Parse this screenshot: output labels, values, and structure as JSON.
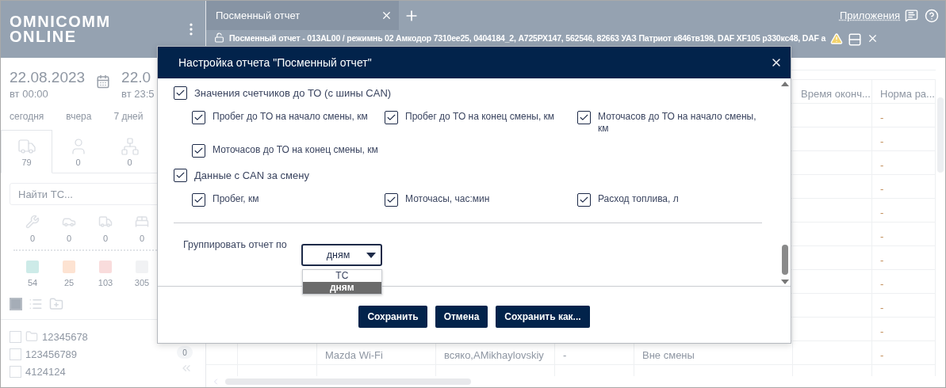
{
  "sidebar": {
    "logo": [
      "OMNICOMM",
      "ONLINE"
    ],
    "period": [
      {
        "date": "22.08.2023",
        "time": "вт 00:00"
      },
      {
        "date": "22.0",
        "time": "вт 23:5"
      }
    ],
    "quick_ranges": [
      "сегодня",
      "вчера",
      "7 дней"
    ],
    "object_tabs": [
      {
        "kind": "vehicles",
        "count": "79",
        "selected": true
      },
      {
        "kind": "drivers",
        "count": "0",
        "selected": false
      },
      {
        "kind": "geozones",
        "count": "0",
        "selected": false
      }
    ],
    "search": {
      "placeholder": "Найти ТС..."
    },
    "state_counters": [
      {
        "kind": "repair",
        "count": "0"
      },
      {
        "kind": "accident",
        "count": "0"
      },
      {
        "kind": "transit",
        "count": "0"
      },
      {
        "kind": "rest",
        "count": "0"
      }
    ],
    "color_counters": [
      {
        "color": "#cdebe8",
        "count": "54"
      },
      {
        "color": "#fde3d2",
        "count": "25"
      },
      {
        "color": "#f9dcdc",
        "count": "103"
      },
      {
        "color": "#f1f2f4",
        "count": "305"
      }
    ],
    "select_all": {
      "indeterminate": true
    },
    "tree_items": [
      {
        "kind": "folder",
        "label": "12345678",
        "checked": false
      },
      {
        "kind": "item",
        "label": "123456789",
        "checked": false
      },
      {
        "kind": "item",
        "label": "4124124",
        "checked": false
      }
    ],
    "side_badge": "0"
  },
  "tabs": [
    {
      "label": "Посменный отчет",
      "selected": true
    }
  ],
  "header_link": "Приложения",
  "report_bar": {
    "title": "Посменный отчет - 013AL00 / режимнь 02 Амкодор 7310ее25, 0404184_2, А725РХ147, 562546, 82663 УАЗ Патриот к846тв198, DAF XF105 р330кс48, DAF а"
  },
  "table": {
    "columns": [
      {
        "label": "Время оконч..."
      },
      {
        "label": "Норма ра..."
      }
    ],
    "rows": [
      {
        "norm": "-"
      },
      {
        "norm": "-"
      },
      {
        "norm": "-"
      },
      {
        "norm": "-"
      },
      {
        "norm": "-"
      },
      {
        "norm": "-"
      },
      {
        "norm": "-"
      },
      {
        "norm": "-"
      },
      {
        "norm": "-"
      },
      {
        "norm": "-"
      },
      {
        "vehicle": "Mazda Wi-Fi",
        "driver": "всяко,AMikhaylovskiy",
        "column_5": "-",
        "status": "Вне смены",
        "norm": "-"
      }
    ]
  },
  "dialog": {
    "title": "Настройка отчета \"Посменный отчет\"",
    "sections": [
      {
        "label": "Значения счетчиков до ТО (с шины CAN)",
        "checked": true,
        "items": [
          {
            "label": "Пробег до ТО на начало смены, км",
            "checked": true
          },
          {
            "label": "Пробег до ТО на конец смены, км",
            "checked": true
          },
          {
            "label": "Моточасов до ТО на начало смены, км",
            "checked": true
          },
          {
            "label": "Моточасов до ТО на конец смены, км",
            "checked": true
          }
        ]
      },
      {
        "label": "Данные с CAN за смену",
        "checked": true,
        "items": [
          {
            "label": "Пробег, км",
            "checked": true
          },
          {
            "label": "Моточасы, час:мин",
            "checked": true
          },
          {
            "label": "Расход топлива, л",
            "checked": true
          }
        ]
      }
    ],
    "group_by": {
      "label": "Группировать отчет по",
      "value": "дням",
      "expanded": true,
      "options": [
        {
          "label": "ТС",
          "selected": false
        },
        {
          "label": "дням",
          "selected": true
        }
      ]
    },
    "buttons": [
      "Сохранить",
      "Отмена",
      "Сохранить как..."
    ]
  }
}
